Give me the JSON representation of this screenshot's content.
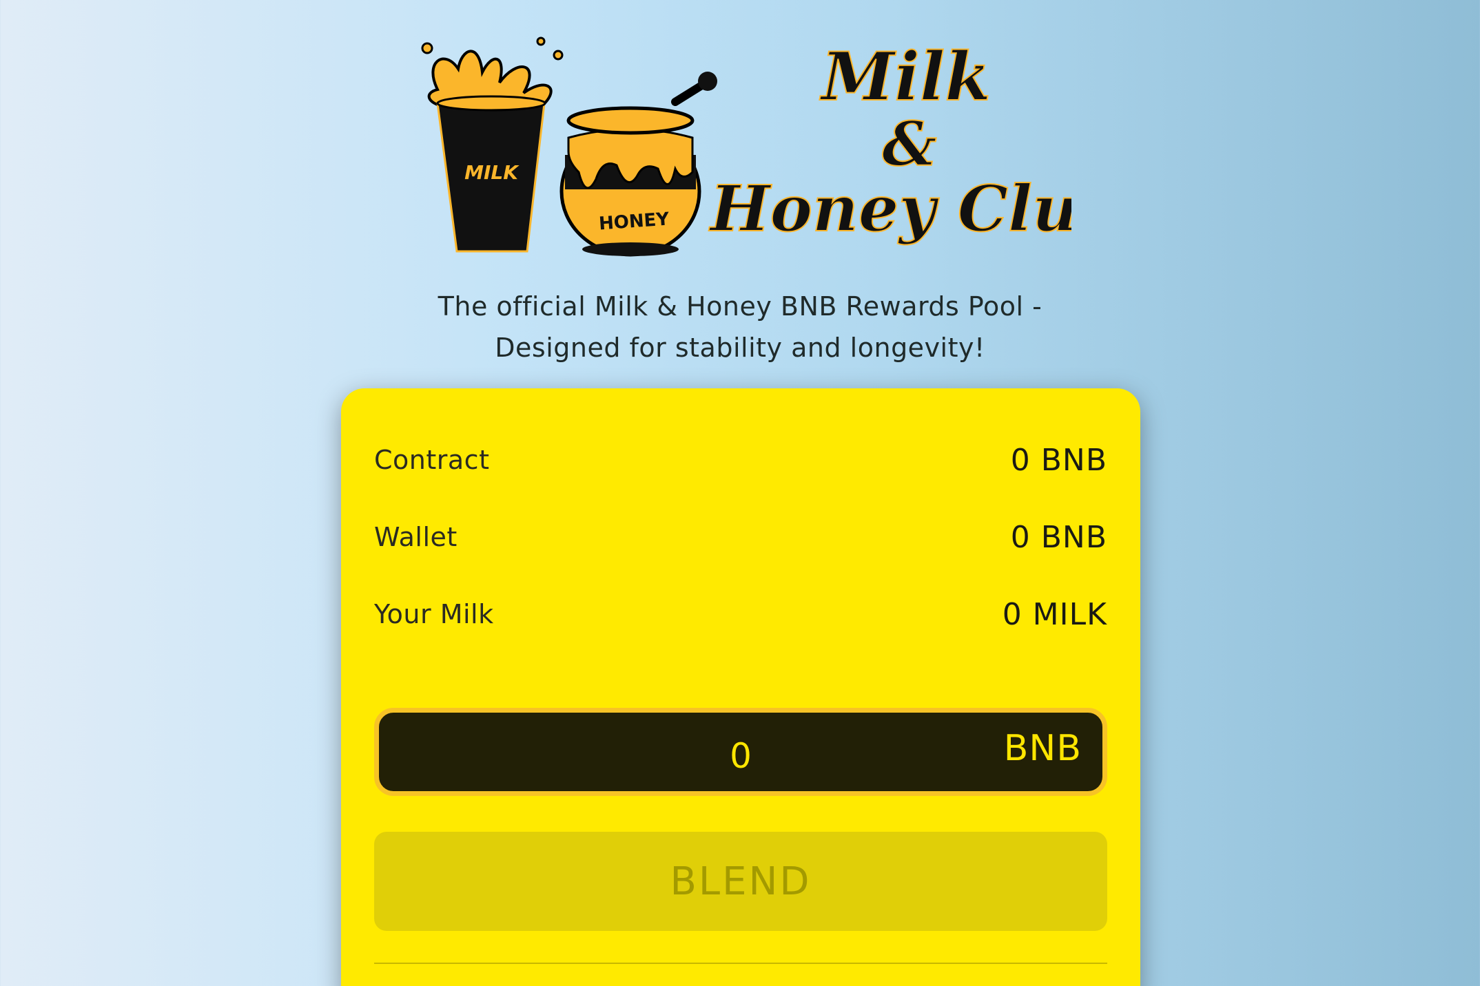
{
  "logo": {
    "cup_label": "MILK",
    "pot_label": "HONEY",
    "title_line1": "Milk",
    "title_line2": "&",
    "title_line3": "Honey Club"
  },
  "tagline": {
    "line1": "The official Milk & Honey BNB Rewards Pool -",
    "line2": "Designed for stability and longevity!"
  },
  "stats": [
    {
      "label": "Contract",
      "value": "0 BNB"
    },
    {
      "label": "Wallet",
      "value": "0 BNB"
    },
    {
      "label": "Your Milk",
      "value": "0 MILK"
    }
  ],
  "amount": {
    "value": "0",
    "unit": "BNB"
  },
  "blend_button": "BLEND",
  "colors": {
    "card": "#ffea00",
    "input_bg": "#222006",
    "input_border": "#f7c326",
    "button_disabled": "#e0cf08",
    "honey": "#fbb62b"
  }
}
